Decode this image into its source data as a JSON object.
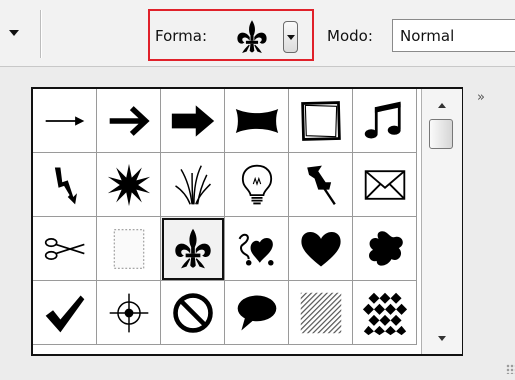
{
  "toolbar": {
    "forma_label": "Forma:",
    "forma_selected_icon": "fleur-de-lis-icon",
    "modo_label": "Modo:",
    "modo_value": "Normal",
    "highlight_color": "#e0212a"
  },
  "panel": {
    "menu_glyph": "»",
    "selected_index": 14,
    "shapes": [
      "thin-arrow-icon",
      "bold-arrow-icon",
      "heavy-arrow-icon",
      "banner-icon",
      "rough-frame-icon",
      "music-note-icon",
      "lightning-icon",
      "starburst-icon",
      "grass-icon",
      "light-bulb-icon",
      "push-pin-icon",
      "envelope-icon",
      "scissors-icon",
      "dotted-frame-icon",
      "fleur-de-lis-icon",
      "ornament-icon",
      "heart-icon",
      "splat-icon",
      "checkmark-icon",
      "target-icon",
      "no-sign-icon",
      "speech-bubble-icon",
      "diagonal-stripes-icon",
      "diamond-grid-icon"
    ]
  }
}
